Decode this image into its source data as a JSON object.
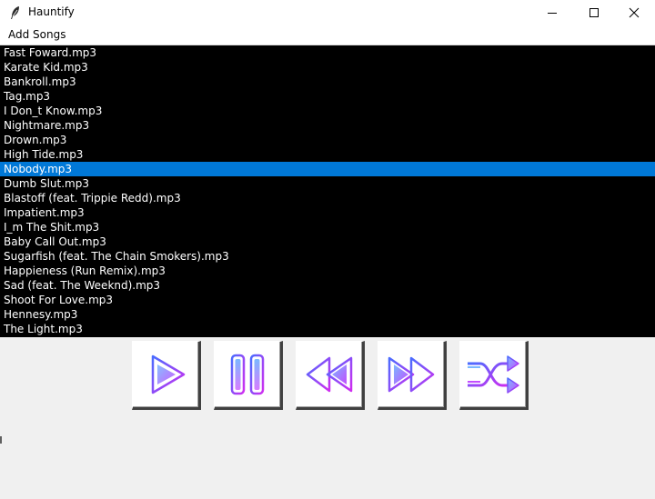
{
  "window": {
    "title": "Hauntify",
    "icon": "feather-icon"
  },
  "menu": {
    "add_songs": "Add Songs"
  },
  "playlist": {
    "songs": [
      "Fast Foward.mp3",
      "Karate Kid.mp3",
      "Bankroll.mp3",
      "Tag.mp3",
      "I Don_t Know.mp3",
      "Nightmare.mp3",
      "Drown.mp3",
      "High Tide.mp3",
      "Nobody.mp3",
      "Dumb Slut.mp3",
      "Blastoff (feat. Trippie Redd).mp3",
      "Impatient.mp3",
      "I_m The Shit.mp3",
      "Baby Call Out.mp3",
      "Sugarfish (feat. The Chain Smokers).mp3",
      "Happieness (Run Remix).mp3",
      "Sad (feat. The Weeknd).mp3",
      "Shoot For Love.mp3",
      "Hennesy.mp3",
      "The Light.mp3"
    ],
    "selected_index": 8
  },
  "controls": [
    {
      "name": "play-button",
      "icon": "play-icon"
    },
    {
      "name": "pause-button",
      "icon": "pause-icon"
    },
    {
      "name": "previous-button",
      "icon": "rewind-icon"
    },
    {
      "name": "next-button",
      "icon": "fast-forward-icon"
    },
    {
      "name": "shuffle-button",
      "icon": "shuffle-icon"
    }
  ],
  "colors": {
    "list_bg": "#000000",
    "list_text": "#ffffff",
    "selection": "#0078d7",
    "icon_gradient_start": "#7ab8ff",
    "icon_gradient_end": "#c44dff",
    "icon_stroke_start": "#4a6cff",
    "icon_stroke_end": "#d02cf0"
  }
}
